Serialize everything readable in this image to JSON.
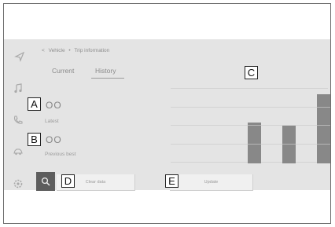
{
  "breadcrumb": {
    "back": "<",
    "parent": "Vehicle",
    "separator": "•",
    "current": "Trip information"
  },
  "tabs": [
    {
      "label": "Current"
    },
    {
      "label": "History"
    }
  ],
  "stats": {
    "latest": {
      "value": "OO",
      "label": "Latest"
    },
    "previous_best": {
      "value": "OO",
      "label": "Previous best"
    }
  },
  "chart_data": {
    "type": "bar",
    "values": [
      0.59,
      0.54,
      1.0
    ],
    "gridlines": 5
  },
  "buttons": {
    "clear_data": "Clear data",
    "update": "Update"
  },
  "callouts": {
    "a": "A",
    "b": "B",
    "c": "C",
    "d": "D",
    "e": "E"
  },
  "rail_icons": [
    "navigation-icon",
    "music-icon",
    "phone-icon",
    "car-icon",
    "settings-icon"
  ],
  "colors": {
    "screen": "#e4e4e4",
    "bar": "#888888",
    "search_button": "#5d5d5d"
  }
}
